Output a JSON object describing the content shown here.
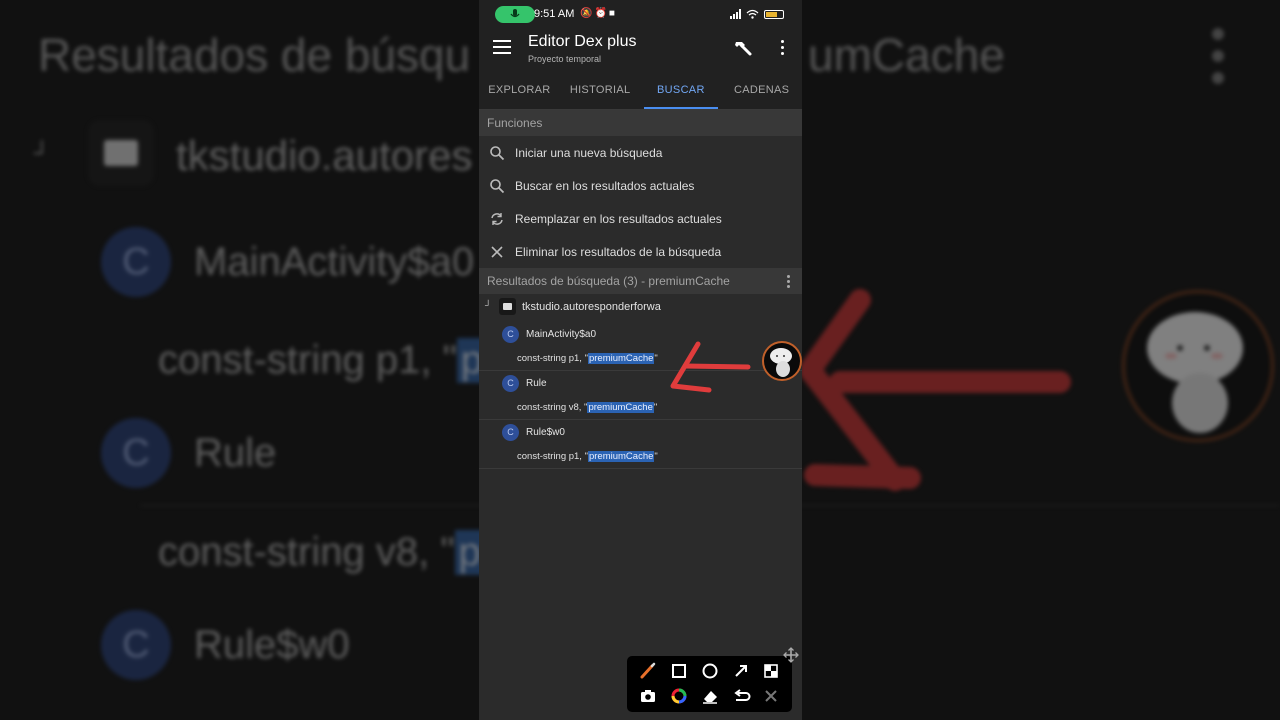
{
  "background": {
    "title": "Resultados de búsqu",
    "title_right": "umCache",
    "package": "tkstudio.autores",
    "classes": [
      {
        "badge": "C",
        "name": "MainActivity$a0"
      },
      {
        "badge": "C",
        "name": "Rule"
      },
      {
        "badge": "C",
        "name": "Rule$w0"
      }
    ],
    "lines": [
      {
        "prefix": "const-string p1, \"",
        "selected": "pr"
      },
      {
        "prefix": "const-string v8, \"",
        "selected": "pr"
      }
    ]
  },
  "status_bar": {
    "time": "9:51 AM",
    "icons": [
      "mic-icon",
      "mute-icon",
      "alarm-icon",
      "record-icon",
      "signal-icon",
      "wifi-icon",
      "battery-icon"
    ]
  },
  "app_bar": {
    "title": "Editor Dex plus",
    "subtitle": "Proyecto temporal"
  },
  "tabs": [
    {
      "label": "EXPLORAR",
      "active": false
    },
    {
      "label": "HISTORIAL",
      "active": false
    },
    {
      "label": "BUSCAR",
      "active": true
    },
    {
      "label": "CADENAS",
      "active": false
    }
  ],
  "functions": {
    "header": "Funciones",
    "items": [
      {
        "label": "Iniciar una nueva búsqueda",
        "icon": "search-icon"
      },
      {
        "label": "Buscar en los resultados actuales",
        "icon": "search-icon"
      },
      {
        "label": "Reemplazar en los resultados actuales",
        "icon": "replace-icon"
      },
      {
        "label": "Eliminar los resultados de la búsqueda",
        "icon": "close-icon"
      }
    ]
  },
  "results": {
    "header": "Resultados de búsqueda (3) - premiumCache",
    "package": "tkstudio.autoresponderforwa",
    "entries": [
      {
        "badge": "C",
        "class_name": "MainActivity$a0",
        "prefix": "const-string p1, \"",
        "match": "premiumCache",
        "suffix": "\""
      },
      {
        "badge": "C",
        "class_name": "Rule",
        "prefix": "const-string v8, \"",
        "match": "premiumCache",
        "suffix": "\""
      },
      {
        "badge": "C",
        "class_name": "Rule$w0",
        "prefix": "const-string p1, \"",
        "match": "premiumCache",
        "suffix": "\""
      }
    ]
  },
  "colors": {
    "accent": "#4a8ef0",
    "highlight": "#2b63b3",
    "annotation_red": "#e03c3c",
    "mic_green": "#35c46b"
  },
  "annotation_toolbar": {
    "tools": [
      "brush-icon",
      "rectangle-icon",
      "circle-icon",
      "arrow-icon",
      "mosaic-icon",
      "camera-icon",
      "color-picker-icon",
      "eraser-icon",
      "undo-icon",
      "close-icon"
    ]
  }
}
